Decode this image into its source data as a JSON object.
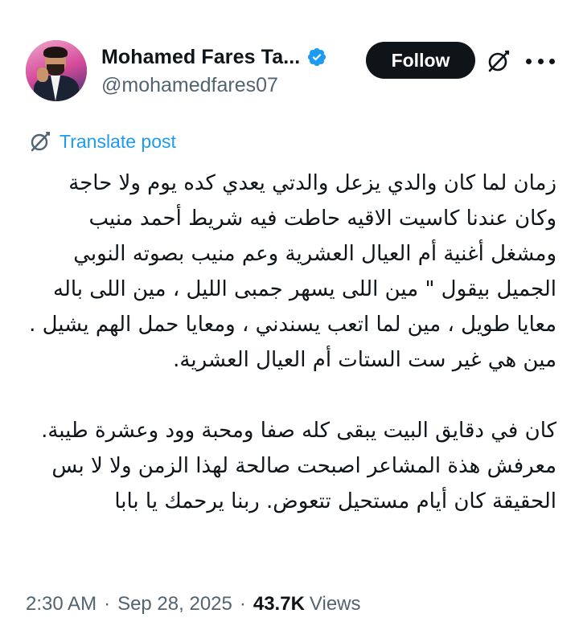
{
  "author": {
    "display_name": "Mohamed Fares Ta...",
    "handle": "@mohamedfares07",
    "verified": true
  },
  "actions": {
    "follow_label": "Follow",
    "grok_icon": "grok-icon",
    "more_icon": "more-icon"
  },
  "translate": {
    "label": "Translate post",
    "icon": "translate-icon"
  },
  "post": {
    "paragraphs": [
      "زمان لما كان والدي يزعل والدتي يعدي كده يوم ولا حاجة وكان عندنا كاسيت الاقيه حاطت فيه شريط أحمد منيب ومشغل أغنية أم العيال العشرية وعم منيب بصوته النوبي الجميل بيقول \" مين اللى يسهر جمبى الليل ، مين اللى باله معايا طويل ، مين لما اتعب يسندني ، ومعايا حمل الهم يشيل . مين هي غير ست الستات أم العيال العشرية.",
      "كان في دقايق البيت يبقى كله صفا ومحبة وود وعشرة طيبة. معرفش هذة المشاعر اصبحت صالحة لهذا الزمن ولا لا بس الحقيقة كان أيام مستحيل تتعوض. ربنا يرحمك يا بابا"
    ]
  },
  "meta": {
    "time": "2:30 AM",
    "date": "Sep 28, 2025",
    "views_count": "43.7K",
    "views_label": "Views",
    "separator": "·"
  },
  "colors": {
    "text": "#0f1419",
    "secondary": "#536471",
    "link": "#1d9bf0",
    "verified": "#1d9bf0",
    "button_bg": "#0f1419"
  }
}
